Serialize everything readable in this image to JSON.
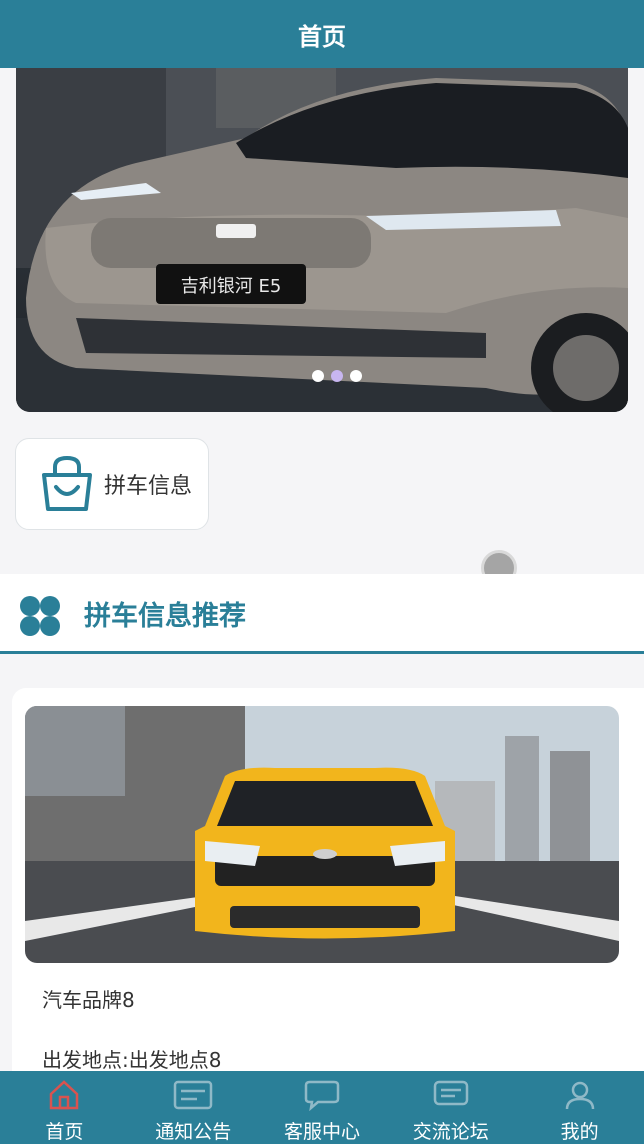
{
  "header": {
    "title": "首页"
  },
  "banner": {
    "badge_text": "吉利银河 E5",
    "dots": [
      {
        "active": false
      },
      {
        "active": true
      },
      {
        "active": false
      }
    ]
  },
  "menu": {
    "items": [
      {
        "label": "拼车信息",
        "icon": "shopping-bag-icon"
      }
    ]
  },
  "section": {
    "title": "拼车信息推荐",
    "icon": "clover-icon"
  },
  "listing": {
    "brand": "汽车品牌8",
    "place": "出发地点:出发地点8"
  },
  "tabbar": {
    "items": [
      {
        "label": "首页",
        "icon": "home-icon",
        "active": true
      },
      {
        "label": "通知公告",
        "icon": "notice-icon",
        "active": false
      },
      {
        "label": "客服中心",
        "icon": "chat-icon",
        "active": false
      },
      {
        "label": "交流论坛",
        "icon": "forum-icon",
        "active": false
      },
      {
        "label": "我的",
        "icon": "user-icon",
        "active": false
      }
    ]
  },
  "colors": {
    "primary": "#2a7f98",
    "active_tab_icon": "#d9534f",
    "car_yellow": "#f2b51c"
  }
}
